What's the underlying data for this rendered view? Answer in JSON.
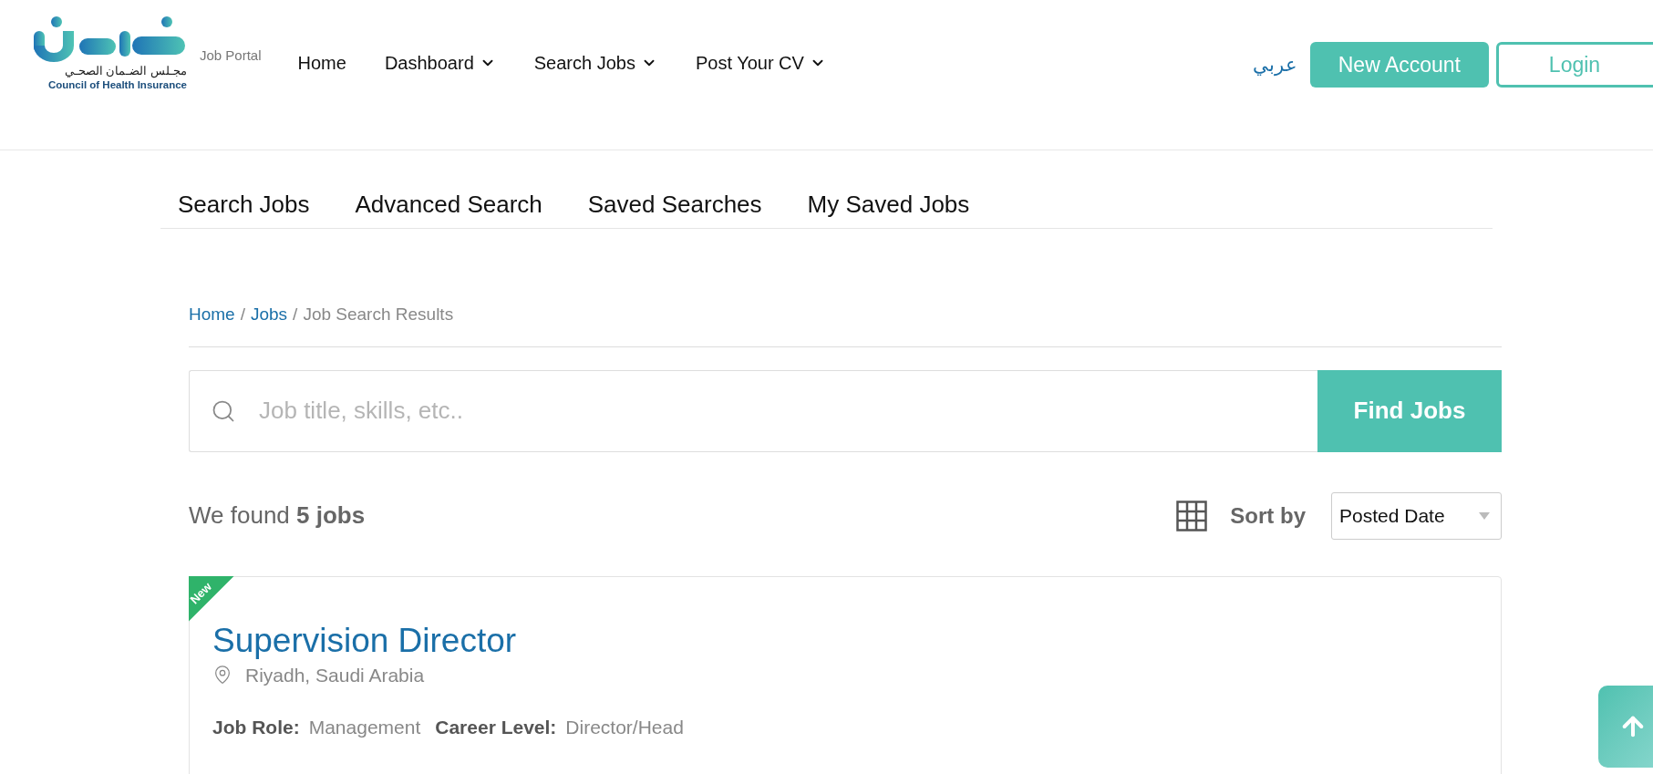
{
  "header": {
    "logo": {
      "arabic_name": "مجـلس الضـمان الصحـي",
      "english_name": "Council of Health Insurance"
    },
    "portal_label": "Job Portal",
    "nav": [
      {
        "label": "Home",
        "dropdown": false
      },
      {
        "label": "Dashboard",
        "dropdown": true
      },
      {
        "label": "Search Jobs",
        "dropdown": true
      },
      {
        "label": "Post Your CV",
        "dropdown": true
      }
    ],
    "language": "عربي",
    "buttons": [
      {
        "label": "New Account",
        "kind": "filled"
      },
      {
        "label": "Login",
        "kind": "outline"
      }
    ]
  },
  "tabs": [
    {
      "label": "Search Jobs"
    },
    {
      "label": "Advanced Search"
    },
    {
      "label": "Saved Searches"
    },
    {
      "label": "My Saved Jobs"
    }
  ],
  "breadcrumb": {
    "separator": "/",
    "items": [
      {
        "label": "Home",
        "link": true
      },
      {
        "label": "Jobs",
        "link": true
      },
      {
        "label": "Job Search Results",
        "link": false
      }
    ]
  },
  "search": {
    "placeholder": "Job title, skills, etc..",
    "button": "Find Jobs"
  },
  "results": {
    "summary": "We found **5 jobs**",
    "sort_label": "Sort by",
    "sort_value": "Posted Date"
  },
  "jobs": [
    {
      "badge": "New",
      "title": "Supervision Director",
      "location": "Riyadh, Saudi Arabia",
      "fields": [
        {
          "label": "Job Role:",
          "value": "Management"
        },
        {
          "label": "Career Level:",
          "value": "Director/Head"
        }
      ]
    }
  ]
}
